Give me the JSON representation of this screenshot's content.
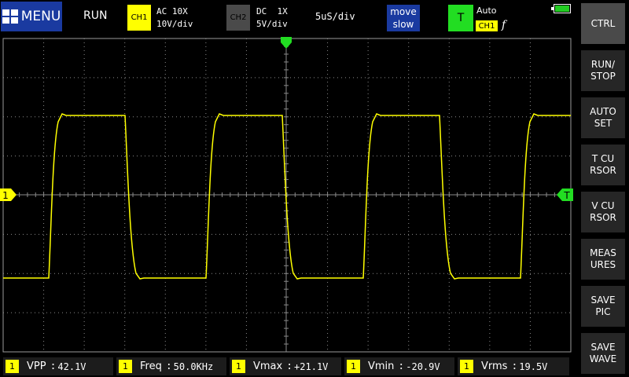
{
  "header": {
    "menu_label": "MENU",
    "run_state": "RUN",
    "ch1": {
      "tag": "CH1",
      "coupling": "AC 10X",
      "scale": "10V/div"
    },
    "ch2": {
      "tag": "CH2",
      "coupling": "DC  1X",
      "scale": "5V/div"
    },
    "timebase": "5uS/div",
    "move_mode": {
      "line1": "move",
      "line2": "slow"
    },
    "trigger": {
      "tag": "T",
      "mode": "Auto",
      "source": "CH1",
      "edge": "f"
    },
    "battery_level": 1.0
  },
  "plot": {
    "ch1_marker": "1",
    "trigger_marker": "T",
    "colors": {
      "trace": "#ffff00",
      "grid": "#8a8a8a",
      "trigger": "#22dd22",
      "border": "#9a9a9a"
    }
  },
  "right_panel": {
    "buttons": [
      {
        "label": "CTRL",
        "active": true
      },
      {
        "label": "RUN/\nSTOP"
      },
      {
        "label": "AUTO\nSET"
      },
      {
        "label": "T CU\nRSOR"
      },
      {
        "label": "V CU\nRSOR"
      },
      {
        "label": "MEAS\nURES"
      },
      {
        "label": "SAVE\nPIC"
      },
      {
        "label": "SAVE\nWAVE"
      }
    ]
  },
  "measurements": [
    {
      "source": "1",
      "name": "VPP",
      "value": "42.1V"
    },
    {
      "source": "1",
      "name": "Freq",
      "value": "50.0KHz"
    },
    {
      "source": "1",
      "name": "Vmax",
      "value": "+21.1V"
    },
    {
      "source": "1",
      "name": "Vmin",
      "value": "-20.9V"
    },
    {
      "source": "1",
      "name": "Vrms",
      "value": "19.5V"
    }
  ]
}
